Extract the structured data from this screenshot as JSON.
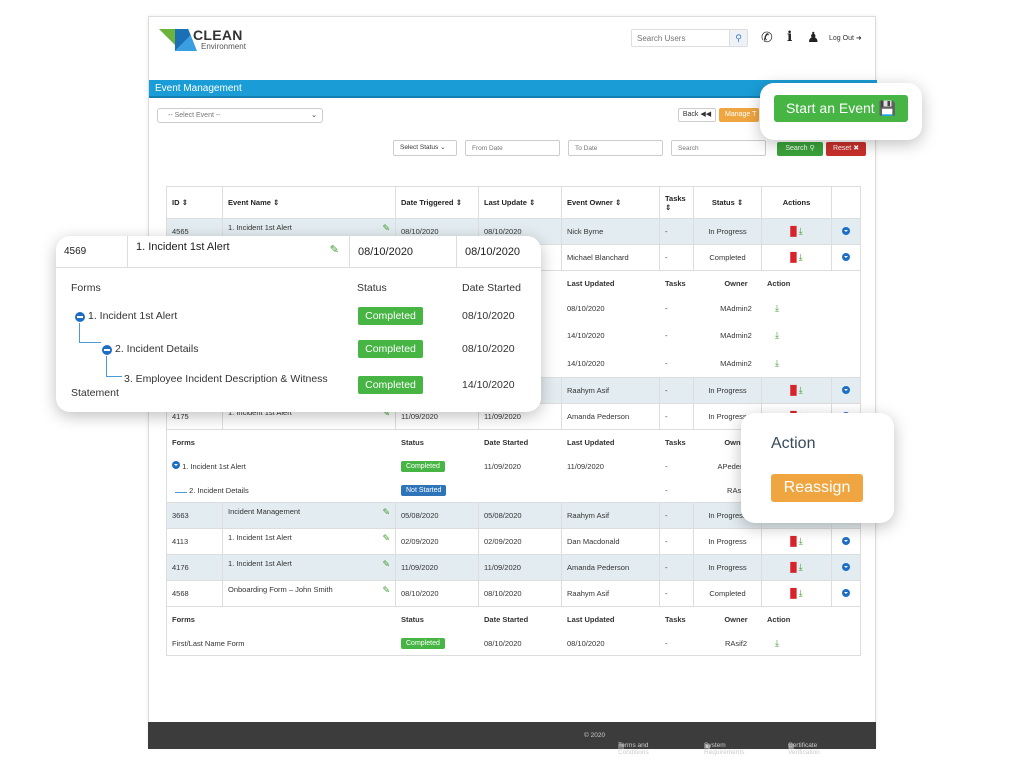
{
  "header": {
    "logo_title": "CLEAN",
    "logo_subtitle": "Environment",
    "search_placeholder": "Search Users",
    "logout_label": "Log Out",
    "icons": [
      "phone-icon",
      "info-icon",
      "user-icon",
      "logout-icon"
    ]
  },
  "page_title": "Event Management",
  "toolbar": {
    "select_event": "-- Select Event --",
    "back_label": "Back",
    "manage_label": "Manage T",
    "start_event_label": "Start an Event"
  },
  "filters": {
    "status_select": "Select Status",
    "from_date_placeholder": "From Date",
    "to_date_placeholder": "To Date",
    "search_placeholder": "Search",
    "search_button": "Search",
    "reset_button": "Reset"
  },
  "table": {
    "columns": [
      "ID",
      "Event Name",
      "Date Triggered",
      "Last Update",
      "Event Owner",
      "Tasks",
      "Status",
      "Actions",
      ""
    ],
    "rows": [
      {
        "id": "4565",
        "name": "1. Incident 1st Alert",
        "triggered": "08/10/2020",
        "updated": "08/10/2020",
        "owner": "Nick Byrne",
        "tasks": "-",
        "status": "In Progress"
      },
      {
        "id": "4569",
        "name": "1. Incident 1st Alert",
        "triggered": "08/10/2020",
        "updated": "08/10/2020",
        "owner": "Michael Blanchard",
        "tasks": "-",
        "status": "Completed"
      },
      {
        "id": "",
        "name": "",
        "triggered": "",
        "updated": "",
        "owner": "Raahym Asif",
        "tasks": "-",
        "status": "In Progress"
      },
      {
        "id": "4175",
        "name": "1. Incident 1st Alert",
        "triggered": "11/09/2020",
        "updated": "11/09/2020",
        "owner": "Amanda Pederson",
        "tasks": "-",
        "status": "In Progress"
      },
      {
        "id": "3663",
        "name": "Incident Management",
        "triggered": "05/08/2020",
        "updated": "05/08/2020",
        "owner": "Raahym Asif",
        "tasks": "-",
        "status": "In Progress"
      },
      {
        "id": "4113",
        "name": "1. Incident 1st Alert",
        "triggered": "02/09/2020",
        "updated": "02/09/2020",
        "owner": "Dan Macdonald",
        "tasks": "-",
        "status": "In Progress"
      },
      {
        "id": "4176",
        "name": "1. Incident 1st Alert",
        "triggered": "11/09/2020",
        "updated": "11/09/2020",
        "owner": "Amanda Pederson",
        "tasks": "-",
        "status": "In Progress"
      },
      {
        "id": "4568",
        "name": "Onboarding Form – John Smith",
        "triggered": "08/10/2020",
        "updated": "08/10/2020",
        "owner": "Raahym Asif",
        "tasks": "-",
        "status": "Completed"
      }
    ],
    "sub_columns": [
      "Forms",
      "Status",
      "Date Started",
      "Last Updated",
      "Tasks",
      "Owner",
      "Action"
    ],
    "sub_4569": [
      {
        "form": "1. Incident 1st Alert",
        "status": "Completed",
        "started": "08/10/2020",
        "updated": "08/10/2020",
        "tasks": "-",
        "owner": "MAdmin2"
      },
      {
        "form": "2. Incident Details",
        "status": "Completed",
        "started": "08/10/2020",
        "updated": "14/10/2020",
        "tasks": "-",
        "owner": "MAdmin2"
      },
      {
        "form": "3. Employee Incident Description & Witness Statement",
        "status": "Completed",
        "started": "14/10/2020",
        "updated": "14/10/2020",
        "tasks": "-",
        "owner": "MAdmin2"
      }
    ],
    "sub_4175": [
      {
        "form": "1. Incident 1st Alert",
        "status": "Completed",
        "started": "11/09/2020",
        "updated": "11/09/2020",
        "tasks": "-",
        "owner": "APederson"
      },
      {
        "form": "2. Incident Details",
        "status": "Not Started",
        "started": "",
        "updated": "",
        "tasks": "-",
        "owner": "RAsif"
      }
    ],
    "sub_4568": [
      {
        "form": "First/Last Name Form",
        "status": "Completed",
        "started": "08/10/2020",
        "updated": "08/10/2020",
        "tasks": "-",
        "owner": "RAsif2"
      }
    ]
  },
  "callout_zoom": {
    "id": "4569",
    "name": "1. Incident 1st Alert",
    "triggered": "08/10/2020",
    "updated": "08/10/2020",
    "col_forms": "Forms",
    "col_status": "Status",
    "col_started": "Date Started",
    "forms": [
      {
        "name": "1. Incident 1st Alert",
        "status": "Completed",
        "started": "08/10/2020"
      },
      {
        "name": "2. Incident Details",
        "status": "Completed",
        "started": "08/10/2020"
      },
      {
        "name": "3. Employee Incident Description & Witness",
        "name_wrap": "Statement",
        "status": "Completed",
        "started": "14/10/2020"
      }
    ]
  },
  "callout_action": {
    "title": "Action",
    "button": "Reassign"
  },
  "footer": {
    "copyright": "© 2020",
    "terms": "Terms and Conditions",
    "sysreq": "System Requirements",
    "cert": "Certificate Verification"
  }
}
